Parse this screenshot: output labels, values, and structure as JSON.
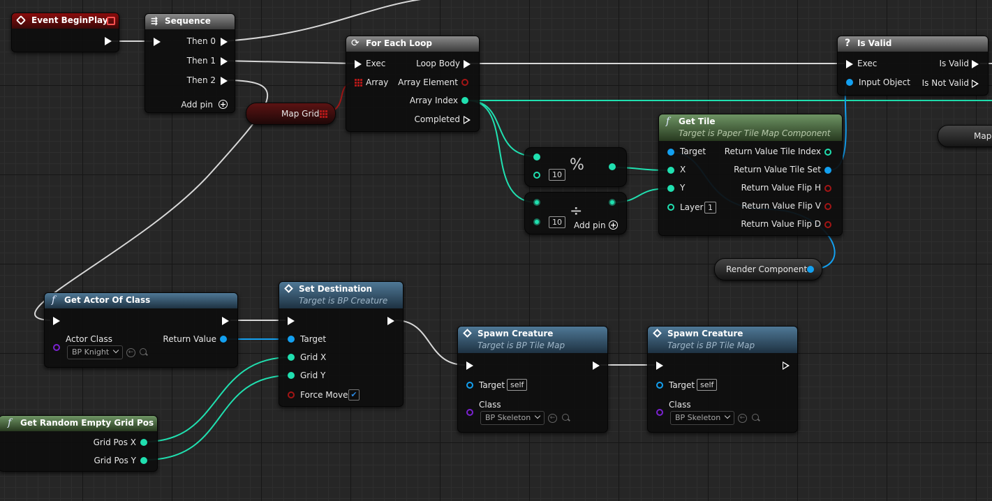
{
  "colors": {
    "exec": "#ffffff",
    "integer": "#20e0b0",
    "object": "#13a0f0",
    "boolean": "#a41515",
    "class": "#7a22d0",
    "event_header": "#8a0d0d",
    "function_header": "#4f7896",
    "pure_header": "#6e9464"
  },
  "event_begin_play": {
    "title": "Event BeginPlay"
  },
  "sequence": {
    "title": "Sequence",
    "then0": "Then 0",
    "then1": "Then 1",
    "then2": "Then 2",
    "add_pin": "Add pin"
  },
  "map_grid_var": {
    "label": "Map Grid"
  },
  "for_each": {
    "title": "For Each Loop",
    "exec": "Exec",
    "array": "Array",
    "loop_body": "Loop Body",
    "array_element": "Array Element",
    "array_index": "Array Index",
    "completed": "Completed"
  },
  "modulo": {
    "symbol": "%",
    "value": "10"
  },
  "divide": {
    "symbol": "÷",
    "value": "10",
    "add_pin": "Add pin"
  },
  "get_tile": {
    "title": "Get Tile",
    "subtitle": "Target is Paper Tile Map Component",
    "target": "Target",
    "x": "X",
    "y": "Y",
    "layer": "Layer",
    "layer_value": "1",
    "ret_index": "Return Value Tile Index",
    "ret_set": "Return Value Tile Set",
    "flip_h": "Return Value Flip H",
    "flip_v": "Return Value Flip V",
    "flip_d": "Return Value Flip D"
  },
  "render_component_var": {
    "label": "Render Component"
  },
  "is_valid": {
    "title": "Is Valid",
    "exec": "Exec",
    "input_object": "Input Object",
    "is_valid": "Is Valid",
    "is_not_valid": "Is Not Valid"
  },
  "map_var_cut": {
    "label": "Map"
  },
  "get_actor": {
    "title": "Get Actor Of Class",
    "actor_class": "Actor Class",
    "class_value": "BP Knight",
    "return_value": "Return Value"
  },
  "set_destination": {
    "title": "Set Destination",
    "subtitle": "Target is BP Creature",
    "target": "Target",
    "grid_x": "Grid X",
    "grid_y": "Grid Y",
    "force_move": "Force Move"
  },
  "spawn1": {
    "title": "Spawn Creature",
    "subtitle": "Target is BP Tile Map",
    "target": "Target",
    "self": "self",
    "class": "Class",
    "class_value": "BP Skeleton"
  },
  "spawn2": {
    "title": "Spawn Creature",
    "subtitle": "Target is BP Tile Map",
    "target": "Target",
    "self": "self",
    "class": "Class",
    "class_value": "BP Skeleton"
  },
  "random_grid": {
    "title": "Get Random Empty Grid Pos",
    "grid_pos_x": "Grid Pos X",
    "grid_pos_y": "Grid Pos Y"
  }
}
